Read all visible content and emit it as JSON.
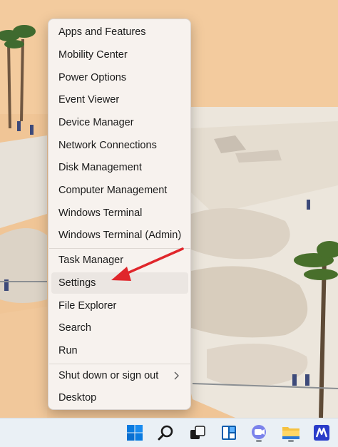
{
  "menu": {
    "items": [
      {
        "label": "Apps and Features"
      },
      {
        "label": "Mobility Center"
      },
      {
        "label": "Power Options"
      },
      {
        "label": "Event Viewer"
      },
      {
        "label": "Device Manager"
      },
      {
        "label": "Network Connections"
      },
      {
        "label": "Disk Management"
      },
      {
        "label": "Computer Management"
      },
      {
        "label": "Windows Terminal"
      },
      {
        "label": "Windows Terminal (Admin)"
      },
      {
        "label": "Task Manager"
      },
      {
        "label": "Settings"
      },
      {
        "label": "File Explorer"
      },
      {
        "label": "Search"
      },
      {
        "label": "Run"
      },
      {
        "label": "Shut down or sign out"
      },
      {
        "label": "Desktop"
      }
    ],
    "selected_item": "Settings",
    "submenu_icon": "chevron-right-icon"
  },
  "annotation": {
    "color": "#e0262b",
    "icon": "red-arrow-icon"
  },
  "taskbar": {
    "icons": [
      "windows-start-icon",
      "search-icon",
      "task-view-icon",
      "widgets-icon",
      "teams-chat-icon",
      "file-explorer-icon",
      "extra-app-icon"
    ],
    "accent": "#0078d4"
  }
}
